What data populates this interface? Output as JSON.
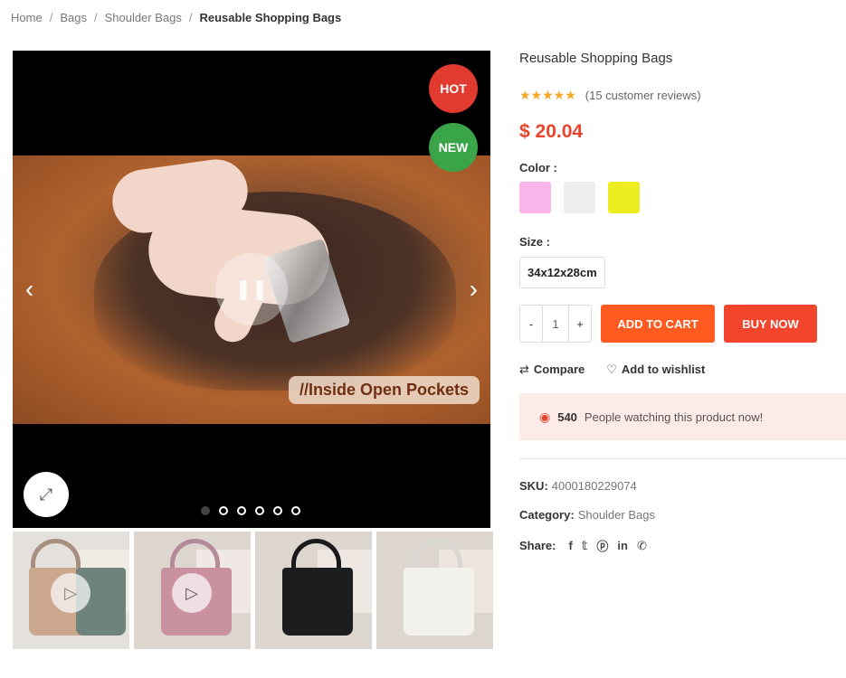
{
  "breadcrumb": {
    "items": [
      "Home",
      "Bags",
      "Shoulder Bags"
    ],
    "separator": "/",
    "current": "Reusable Shopping Bags"
  },
  "gallery": {
    "badges": {
      "hot": "HOT",
      "new": "NEW"
    },
    "video_caption": "//Inside Open Pockets",
    "dot_count": 6,
    "active_dot": 0,
    "thumbnails": [
      {
        "name": "brown-green-bags",
        "has_play": true
      },
      {
        "name": "pink-bag",
        "has_play": true
      },
      {
        "name": "black-bag",
        "has_play": false
      },
      {
        "name": "white-bag",
        "has_play": false
      }
    ]
  },
  "product": {
    "title": "Reusable Shopping Bags",
    "rating_stars": 5,
    "reviews_text": "(15 customer reviews)",
    "price": "$ 20.04",
    "color_label": "Color :",
    "colors": [
      "#f9b4ea",
      "#eeeeee",
      "#eded22"
    ],
    "size_label": "Size :",
    "size_value": "34x12x28cm",
    "quantity": "1",
    "minus": "-",
    "plus": "+",
    "add_to_cart": "ADD TO CART",
    "buy_now": "BUY NOW",
    "compare": "Compare",
    "wishlist": "Add to wishlist",
    "watching_count": "540",
    "watching_text": "People watching this product now!",
    "sku_label": "SKU:",
    "sku_value": "4000180229074",
    "category_label": "Category:",
    "category_value": "Shoulder Bags",
    "share_label": "Share:",
    "share_icons": [
      "facebook-icon",
      "twitter-icon",
      "pinterest-icon",
      "linkedin-icon",
      "whatsapp-icon"
    ]
  },
  "colors": {
    "accent": "#e8442b",
    "cart_button": "#ff5a1f",
    "buy_button": "#f2452c",
    "hot_badge": "#e13a2f",
    "new_badge": "#3aa548",
    "star": "#f5a623"
  }
}
